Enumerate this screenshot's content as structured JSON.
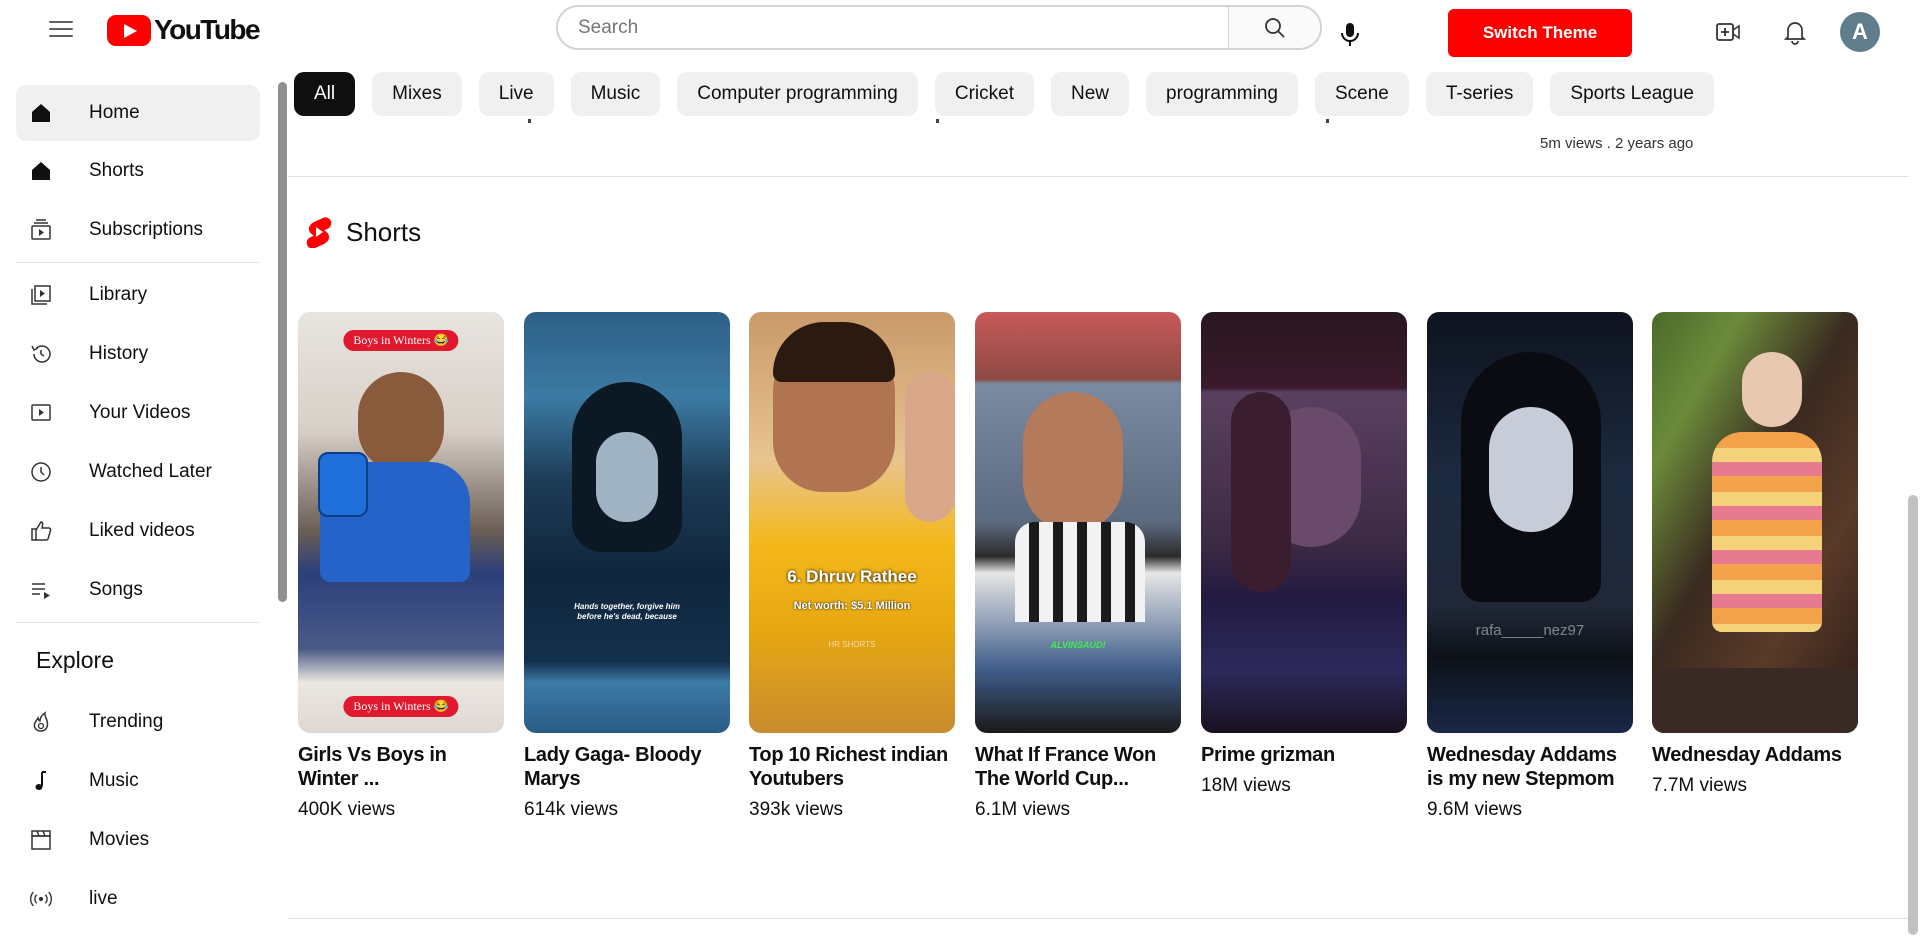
{
  "header": {
    "logo_text": "YouTube",
    "search_placeholder": "Search",
    "theme_button": "Switch Theme",
    "avatar_letter": "A"
  },
  "sidebar": {
    "items": [
      {
        "label": "Home",
        "icon": "home-icon",
        "active": true
      },
      {
        "label": "Shorts",
        "icon": "shorts-icon"
      },
      {
        "label": "Subscriptions",
        "icon": "subscriptions-icon"
      },
      {
        "label": "Library",
        "icon": "library-icon"
      },
      {
        "label": "History",
        "icon": "history-icon"
      },
      {
        "label": "Your Videos",
        "icon": "your-videos-icon"
      },
      {
        "label": "Watched Later",
        "icon": "clock-icon"
      },
      {
        "label": "Liked videos",
        "icon": "thumbs-up-icon"
      },
      {
        "label": "Songs",
        "icon": "playlist-icon"
      }
    ],
    "explore_heading": "Explore",
    "explore_items": [
      {
        "label": "Trending",
        "icon": "fire-icon"
      },
      {
        "label": "Music",
        "icon": "music-note-icon"
      },
      {
        "label": "Movies",
        "icon": "clapperboard-icon"
      },
      {
        "label": "live",
        "icon": "live-broadcast-icon"
      }
    ]
  },
  "chips": [
    "All",
    "Mixes",
    "Live",
    "Music",
    "Computer programming",
    "Cricket",
    "New",
    "programming",
    "Scene",
    "T-series",
    "Sports League"
  ],
  "previous_row": {
    "stats": "5m views . 2 years ago"
  },
  "shorts": {
    "section_title": "Shorts",
    "items": [
      {
        "title": "Girls Vs Boys in Winter ...",
        "views": "400K views",
        "overlay_top": "Boys in Winters 😂",
        "overlay_bottom": "Boys in Winters 😂"
      },
      {
        "title": "Lady Gaga- Bloody Marys",
        "views": "614k views",
        "overlay_caption": "Hands together, forgive him before he's dead, because"
      },
      {
        "title": "Top 10 Richest indian Youtubers",
        "views": "393k views",
        "overlay_name": "6. Dhruv Rathee",
        "overlay_sub": "Net worth: $5.1 Million",
        "overlay_mark": "HR SHORTS"
      },
      {
        "title": "What If France Won The World Cup...",
        "views": "6.1M views",
        "overlay_mark": "ALVINSAUD!"
      },
      {
        "title": "Prime grizman",
        "views": "18M views"
      },
      {
        "title": "Wednesday Addams is my new Stepmom",
        "views": "9.6M views",
        "overlay_mark": "rafa_____nez97"
      },
      {
        "title": "Wednesday Addams",
        "views": "7.7M views"
      }
    ]
  }
}
